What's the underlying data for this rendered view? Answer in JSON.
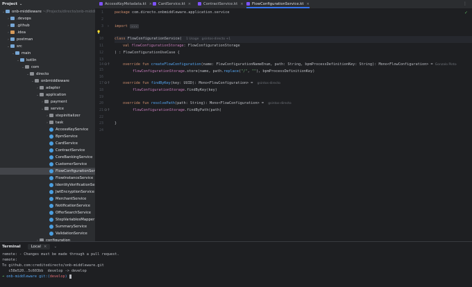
{
  "project": {
    "title": "Project",
    "tree": [
      {
        "label": "onb-middleware",
        "hint": " ~/Projects/directo/onb-middlew",
        "indent": 0,
        "arrow": "▾",
        "icon": "folder"
      },
      {
        "label": ".devops",
        "indent": 1,
        "arrow": "›",
        "icon": "folder"
      },
      {
        "label": ".github",
        "indent": 1,
        "arrow": "›",
        "icon": "folder"
      },
      {
        "label": ".idea",
        "indent": 1,
        "arrow": "›",
        "icon": "folder-orange"
      },
      {
        "label": "postman",
        "indent": 1,
        "arrow": "›",
        "icon": "folder"
      },
      {
        "label": "src",
        "indent": 1,
        "arrow": "▾",
        "icon": "folder"
      },
      {
        "label": "main",
        "indent": 2,
        "arrow": "▾",
        "icon": "folder"
      },
      {
        "label": "kotlin",
        "indent": 3,
        "arrow": "▾",
        "icon": "folder"
      },
      {
        "label": "com",
        "indent": 4,
        "arrow": "▾",
        "icon": "folder-gray"
      },
      {
        "label": "directo",
        "indent": 5,
        "arrow": "▾",
        "icon": "folder-gray"
      },
      {
        "label": "onbmiddleware",
        "indent": 6,
        "arrow": "▾",
        "icon": "folder-gray"
      },
      {
        "label": "adapter",
        "indent": 7,
        "arrow": "›",
        "icon": "folder-gray"
      },
      {
        "label": "application",
        "indent": 7,
        "arrow": "▾",
        "icon": "folder-gray"
      },
      {
        "label": "payment",
        "indent": 8,
        "arrow": "›",
        "icon": "folder-gray"
      },
      {
        "label": "service",
        "indent": 8,
        "arrow": "▾",
        "icon": "folder-gray"
      },
      {
        "label": "stepinitializer",
        "indent": 9,
        "arrow": "›",
        "icon": "folder-gray"
      },
      {
        "label": "task",
        "indent": 9,
        "arrow": "›",
        "icon": "folder-gray"
      },
      {
        "label": "AccessKeyService",
        "indent": 9,
        "arrow": "",
        "icon": "cls"
      },
      {
        "label": "BpmService",
        "indent": 9,
        "arrow": "",
        "icon": "cls"
      },
      {
        "label": "CardService",
        "indent": 9,
        "arrow": "",
        "icon": "cls"
      },
      {
        "label": "ContractService",
        "indent": 9,
        "arrow": "",
        "icon": "cls"
      },
      {
        "label": "CoreBankingService",
        "indent": 9,
        "arrow": "",
        "icon": "cls"
      },
      {
        "label": "CustomerService",
        "indent": 9,
        "arrow": "",
        "icon": "cls"
      },
      {
        "label": "FlowConfigurationService",
        "indent": 9,
        "arrow": "",
        "icon": "cls",
        "selected": true
      },
      {
        "label": "FlowInstanceService",
        "indent": 9,
        "arrow": "",
        "icon": "cls"
      },
      {
        "label": "IdentityVerificationService",
        "indent": 9,
        "arrow": "",
        "icon": "cls"
      },
      {
        "label": "JwtEncryptionService",
        "indent": 9,
        "arrow": "",
        "icon": "cls"
      },
      {
        "label": "MerchantService",
        "indent": 9,
        "arrow": "",
        "icon": "cls"
      },
      {
        "label": "NotificationService",
        "indent": 9,
        "arrow": "",
        "icon": "cls"
      },
      {
        "label": "OfferSearchService",
        "indent": 9,
        "arrow": "",
        "icon": "cls"
      },
      {
        "label": "StepVariablesMapper",
        "indent": 9,
        "arrow": "",
        "icon": "cls"
      },
      {
        "label": "SummaryService",
        "indent": 9,
        "arrow": "",
        "icon": "cls"
      },
      {
        "label": "ValidationService",
        "indent": 9,
        "arrow": "",
        "icon": "cls"
      },
      {
        "label": "configuration",
        "indent": 7,
        "arrow": "›",
        "icon": "folder-gray"
      }
    ]
  },
  "tabs": [
    {
      "label": "AccessKeyMetadata.kt",
      "active": false
    },
    {
      "label": "CardService.kt",
      "active": false
    },
    {
      "label": "ContractService.kt",
      "active": false
    },
    {
      "label": "FlowConfigurationService.kt",
      "active": true
    }
  ],
  "editor": {
    "pkg_kw": "package",
    "pkg_name": " com.directo.onbmiddleware.application.service",
    "import_kw": "import",
    "import_fold": "...",
    "class_kw": "class",
    "class_name": " FlowConfigurationService(",
    "class_hint": "1 Usage   gsintos-directo +1",
    "val_kw": "val",
    "val_name": " flowConfigurationStorage",
    "val_type": ": FlowConfigurationStorage",
    "class_end": ") : FlowConfigurationUseCase {",
    "m1_sig": "override fun ",
    "m1_name": "createFlowConfiguration",
    "m1_rest": "(name: FlowConfigurationNameEnum, path: String, bpmProcessDefinitionKey: String): Mono<FlowConfiguration> =",
    "m1_hint": "Gonzalo Pinto",
    "m1_body_a": "flowConfigurationStorage",
    "m1_body_b": ".store(name, path.",
    "m1_body_c": "replace",
    "m1_body_d": "(",
    "m1_str1": "\"/\"",
    "m1_body_e": ", ",
    "m1_str2": "\"\"",
    "m1_body_f": "), bpmProcessDefinitionKey)",
    "m2_sig": "override fun ",
    "m2_name": "findByKey",
    "m2_rest": "(key: UUID): Mono<FlowConfiguration> =",
    "m2_hint": "gsintos-directo",
    "m2_body_a": "flowConfigurationStorage",
    "m2_body_b": ".findByKey(key)",
    "m3_sig": "override fun ",
    "m3_name": "resolvePath",
    "m3_rest": "(path: String): Mono<FlowConfiguration> =",
    "m3_hint": "gsintos-directo",
    "m3_body_a": "flowConfigurationStorage",
    "m3_body_b": ".findByPath(path)",
    "close1": "}",
    "lines": [
      "1",
      "2",
      "3",
      "",
      "",
      "",
      "",
      "",
      "",
      "",
      "",
      "",
      "",
      "",
      "",
      "",
      "",
      "",
      "",
      "",
      "",
      ""
    ],
    "line_numbers": {
      "l1": "1",
      "l2": "2",
      "l3": "3",
      "l10": "10",
      "l11": "11",
      "l12": "12",
      "l13": "13",
      "l14": "14",
      "l15": "15",
      "l16": "16",
      "l17": "17",
      "l18": "18",
      "l19": "19",
      "l20": "20",
      "l21": "21",
      "l22": "22",
      "l23": "23",
      "l24": "24",
      "l25": "25",
      "l26": "26"
    }
  },
  "terminal": {
    "title": "Terminal",
    "tab": "Local",
    "lines": [
      "remote: - Changes must be made through a pull request.",
      "remote:",
      "To github.com:creditodirecto/onb-middleware.git",
      "   c58e520..5c603bb  develop -> develop"
    ],
    "prompt_dir": "onb-middleware",
    "prompt_git": "git:(",
    "prompt_branch": "develop",
    "prompt_close": ")"
  }
}
